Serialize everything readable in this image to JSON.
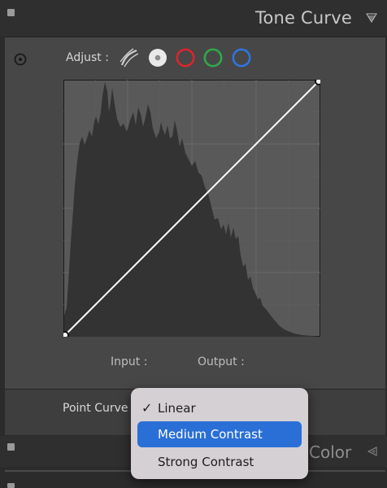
{
  "header": {
    "title": "Tone Curve"
  },
  "adjust": {
    "label": "Adjust :",
    "channels": [
      "parametric-curve-icon",
      "point-curve-white-icon",
      "red-channel-icon",
      "green-channel-icon",
      "blue-channel-icon"
    ]
  },
  "curve": {
    "input_label": "Input :",
    "output_label": "Output :"
  },
  "point_curve": {
    "label": "Point Curve :"
  },
  "dropdown": {
    "items": [
      {
        "label": "Linear",
        "checked": true,
        "highlighted": false
      },
      {
        "label": "Medium Contrast",
        "checked": false,
        "highlighted": true
      },
      {
        "label": "Strong Contrast",
        "checked": false,
        "highlighted": false
      }
    ]
  },
  "lower": {
    "title": "Color"
  },
  "colors": {
    "highlight": "#2a6fd6",
    "red": "#d9262c",
    "green": "#2fa84a",
    "blue": "#2f74e0"
  }
}
